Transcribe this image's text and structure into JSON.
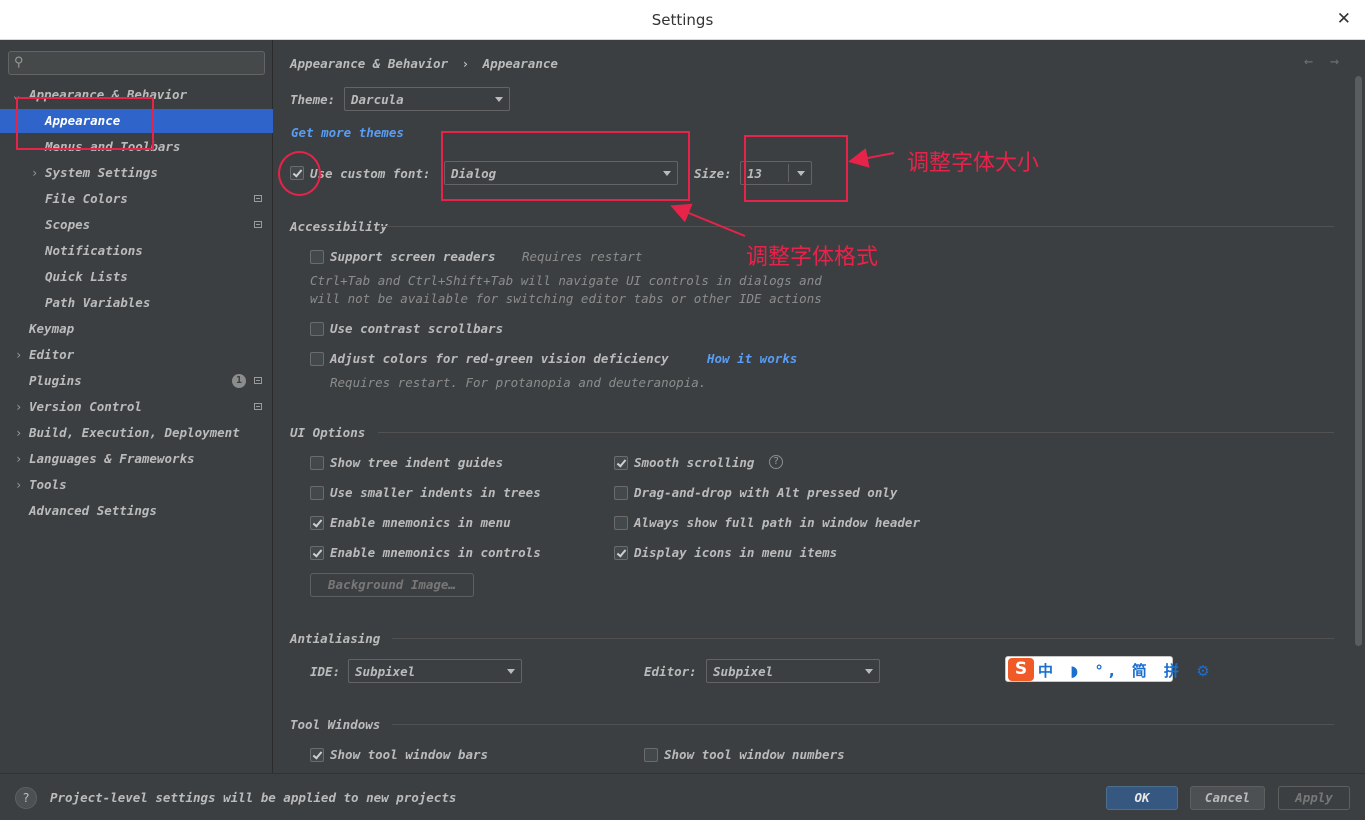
{
  "window": {
    "title": "Settings",
    "close_glyph": "✕"
  },
  "search": {
    "icon": "search-icon",
    "placeholder": ""
  },
  "sidebar": {
    "items": [
      {
        "label": "Appearance & Behavior",
        "arrow": "⌄"
      },
      {
        "label": "Appearance"
      },
      {
        "label": "Menus and Toolbars"
      },
      {
        "label": "System Settings",
        "arrow": "›"
      },
      {
        "label": "File Colors"
      },
      {
        "label": "Scopes"
      },
      {
        "label": "Notifications"
      },
      {
        "label": "Quick Lists"
      },
      {
        "label": "Path Variables"
      },
      {
        "label": "Keymap"
      },
      {
        "label": "Editor",
        "arrow": "›"
      },
      {
        "label": "Plugins",
        "badge": "1"
      },
      {
        "label": "Version Control",
        "arrow": "›"
      },
      {
        "label": "Build, Execution, Deployment",
        "arrow": "›"
      },
      {
        "label": "Languages & Frameworks",
        "arrow": "›"
      },
      {
        "label": "Tools",
        "arrow": "›"
      },
      {
        "label": "Advanced Settings"
      }
    ]
  },
  "breadcrumb": {
    "parent": "Appearance & Behavior",
    "sep": "›",
    "current": "Appearance"
  },
  "nav": {
    "back": "←",
    "forward": "→"
  },
  "theme": {
    "label": "Theme:",
    "value": "Darcula"
  },
  "get_more_themes": "Get more themes",
  "font": {
    "checkbox_label": "Use custom font:",
    "checked": true,
    "value": "Dialog",
    "size_label": "Size:",
    "size_value": "13"
  },
  "accessibility": {
    "title": "Accessibility",
    "screen_readers": {
      "label": "Support screen readers",
      "note": "Requires restart",
      "checked": false
    },
    "screen_readers_desc_1": "Ctrl+Tab and Ctrl+Shift+Tab will navigate UI controls in dialogs and",
    "screen_readers_desc_2": "will not be available for switching editor tabs or other IDE actions",
    "contrast_scrollbars": {
      "label": "Use contrast scrollbars",
      "checked": false
    },
    "color_deficiency": {
      "label": "Adjust colors for red-green vision deficiency",
      "link": "How it works",
      "checked": false
    },
    "color_deficiency_desc": "Requires restart. For protanopia and deuteranopia."
  },
  "ui_options": {
    "title": "UI Options",
    "left": [
      {
        "label": "Show tree indent guides",
        "checked": false
      },
      {
        "label": "Use smaller indents in trees",
        "checked": false
      },
      {
        "label": "Enable mnemonics in menu",
        "checked": true
      },
      {
        "label": "Enable mnemonics in controls",
        "checked": true
      }
    ],
    "right": [
      {
        "label": "Smooth scrolling",
        "checked": true
      },
      {
        "label": "Drag-and-drop with Alt pressed only",
        "checked": false
      },
      {
        "label": "Always show full path in window header",
        "checked": false
      },
      {
        "label": "Display icons in menu items",
        "checked": true
      }
    ],
    "help_glyph": "?",
    "background_image": "Background Image…"
  },
  "antialiasing": {
    "title": "Antialiasing",
    "ide_label": "IDE:",
    "ide_value": "Subpixel",
    "editor_label": "Editor:",
    "editor_value": "Subpixel"
  },
  "tool_windows": {
    "title": "Tool Windows",
    "show_bars": {
      "label": "Show tool window bars",
      "checked": true
    },
    "show_numbers": {
      "label": "Show tool window numbers",
      "checked": false
    }
  },
  "footer": {
    "help": "?",
    "message": "Project-level settings will be applied to new projects",
    "ok": "OK",
    "cancel": "Cancel",
    "apply": "Apply"
  },
  "annotations": {
    "size_note": "调整字体大小",
    "font_note": "调整字体格式"
  },
  "ime": {
    "logo": "S",
    "text": "中 ◗ °, 简 拼 ⚙"
  },
  "colors": {
    "accent": "#2f65ca",
    "annotation": "#e8234a",
    "link": "#589df6",
    "background": "#3c3f41"
  }
}
